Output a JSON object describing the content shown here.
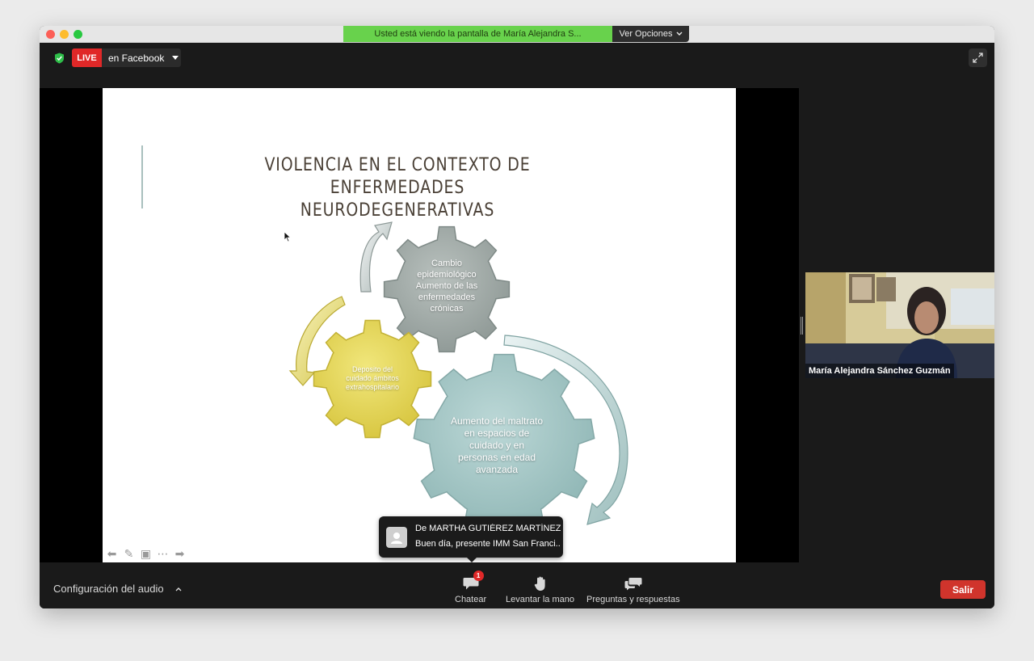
{
  "window": {
    "share_banner": "Usted está viendo la pantalla de María Alejandra S...",
    "view_options_label": "Ver Opciones",
    "view_options_icon": "chevron-down-icon"
  },
  "topbar": {
    "live_label": "LIVE",
    "live_target": "en Facebook",
    "security_icon": "shield-check-icon",
    "fullscreen_icon": "expand-icon",
    "colors": {
      "live": "#e02828",
      "shield": "#2fbf4a"
    }
  },
  "slide": {
    "title": "VIOLENCIA EN EL CONTEXTO DE ENFERMEDADES\nNEURODEGENERATIVAS",
    "gears": [
      {
        "text": "Cambio\nepidemiológico\nAumento de las\nenfermedades\ncrónicas",
        "color": "#9fa9a6"
      },
      {
        "text": "Deposito del\ncuidado ámbitos\nextrahospitalario",
        "color": "#e5d75a"
      },
      {
        "text": "Aumento del maltrato\nen espacios de\ncuidado y en\npersonas en edad\navanzada",
        "color": "#a9c9c8"
      }
    ],
    "nav_icons": [
      "arrow-left-icon",
      "pen-icon",
      "slides-icon",
      "more-icon",
      "arrow-right-icon"
    ]
  },
  "chat_popup": {
    "from": "De MARTHA GUTIÉREZ MARTÍNEZ...",
    "message": "Buen día, presente IMM San Franci..."
  },
  "video": {
    "participant_name": "María Alejandra Sánchez Guzmán"
  },
  "toolbar": {
    "audio_settings": "Configuración del audio",
    "chat_label": "Chatear",
    "chat_badge": "1",
    "raise_hand_label": "Levantar la mano",
    "qa_label": "Preguntas y respuestas",
    "leave_label": "Salir",
    "leave_color": "#d0342c"
  }
}
